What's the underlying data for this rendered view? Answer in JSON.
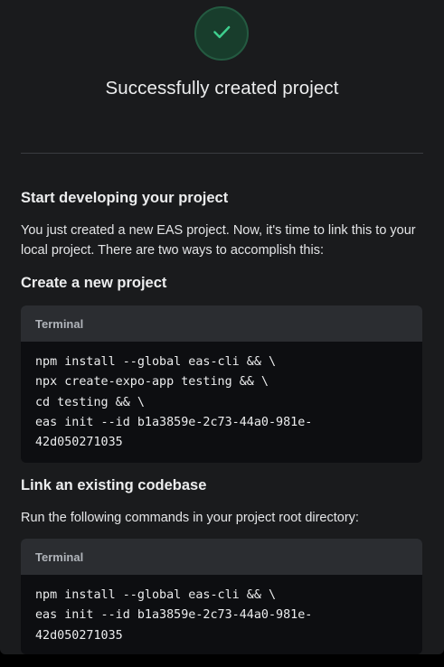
{
  "success": {
    "icon": "check-icon",
    "title": "Successfully created project"
  },
  "start": {
    "heading": "Start developing your project",
    "description_line1": "You just created a new EAS project. Now, it's time to link this to your",
    "description_line2": "local project. There are two ways to accomplish this:"
  },
  "create_new": {
    "heading": "Create a new project",
    "terminal_label": "Terminal",
    "code_lines": [
      "npm install --global eas-cli && \\",
      "npx create-expo-app testing && \\",
      "cd testing && \\",
      "eas init --id b1a3859e-2c73-44a0-981e-",
      "42d050271035"
    ]
  },
  "link_existing": {
    "heading": "Link an existing codebase",
    "description": "Run the following commands in your project root directory:",
    "terminal_label": "Terminal",
    "code_lines": [
      "npm install --global eas-cli && \\",
      "eas init --id b1a3859e-2c73-44a0-981e-",
      "42d050271035"
    ]
  },
  "colors": {
    "success_accent": "#3ecf8e",
    "panel_background": "#1a1b1d",
    "terminal_header": "#2b2d31",
    "terminal_body": "#0d0e11"
  }
}
